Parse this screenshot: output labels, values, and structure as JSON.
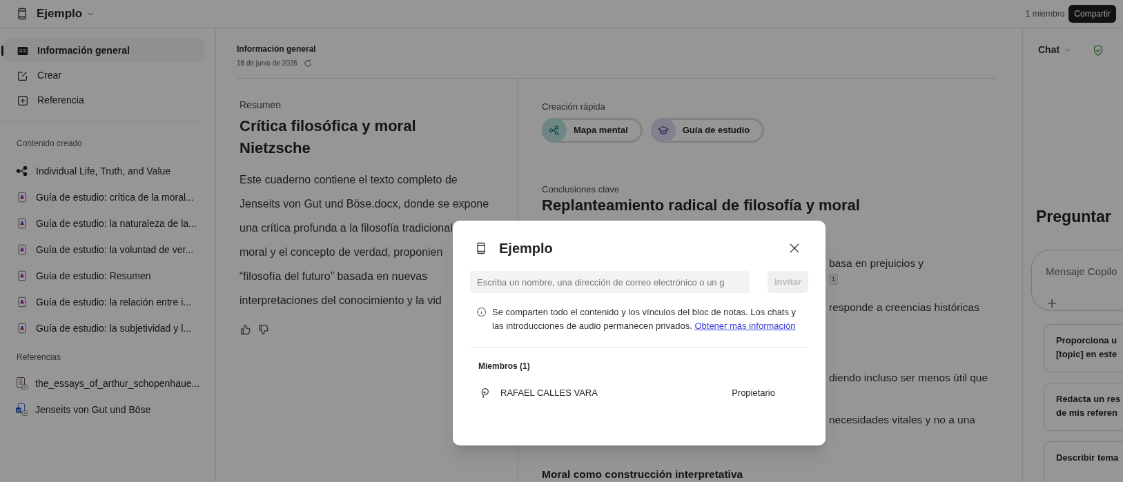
{
  "top_bar": {
    "notebook_title": "Ejemplo",
    "members_count": "1 miembro",
    "share_button": "Compartir"
  },
  "sidebar": {
    "nav": [
      {
        "label": "Información general",
        "selected": true
      },
      {
        "label": "Crear",
        "selected": false
      },
      {
        "label": "Referencia",
        "selected": false
      }
    ],
    "created_heading": "Contenido creado",
    "created": [
      {
        "kind": "mindmap",
        "label": "Individual Life, Truth, and Value"
      },
      {
        "kind": "study_guide",
        "label": "Guía de estudio: crítica de la moral..."
      },
      {
        "kind": "study_guide",
        "label": "Guía de estudio: la naturaleza de la..."
      },
      {
        "kind": "study_guide",
        "label": "Guía de estudio: la voluntad de ver..."
      },
      {
        "kind": "study_guide",
        "label": "Guía de estudio: Resumen"
      },
      {
        "kind": "study_guide",
        "label": "Guía de estudio: la relación entre i..."
      },
      {
        "kind": "study_guide",
        "label": "Guía de estudio: la subjetividad y l..."
      }
    ],
    "references_heading": "Referencias",
    "references": [
      {
        "kind": "pdf",
        "label": "the_essays_of_arthur_schopenhaue..."
      },
      {
        "kind": "word",
        "label": "Jenseits von Gut und Böse"
      }
    ]
  },
  "overview": {
    "title": "Información general",
    "date": "18 de junio de 2026",
    "summary": {
      "label": "Resumen",
      "title": "Crítica filosófica y moral Nietzsche",
      "text_lines": [
        "Este cuaderno contiene el texto completo de",
        "Jenseits von Gut und Böse.docx, donde se expone",
        "una crítica profunda a la filosofía tradicional",
        "moral y el concepto de verdad, proponien",
        "“filosofía del futuro” basada en nuevas",
        "interpretaciones del conocimiento y la vid"
      ]
    },
    "quick_create": {
      "label": "Creación rápida",
      "items": [
        {
          "kind": "mindmap",
          "label": "Mapa mental"
        },
        {
          "kind": "study_guide",
          "label": "Guía de estudio"
        }
      ]
    },
    "key_conclusions": {
      "label": "Conclusiones clave",
      "title": "Replanteamiento radical de filosofía y moral",
      "fragments": [
        {
          "text": "basa en prejuicios y",
          "citation": "1"
        },
        {
          "text": "responde a creencias históricas"
        },
        {
          "text": "diendo incluso ser menos útil que"
        },
        {
          "text": "necesidades vitales y no a una"
        }
      ],
      "subtitle": "Moral como construcción interpretativa"
    }
  },
  "chat": {
    "title": "Chat",
    "heading": "Preguntar",
    "placeholder": "Mensaje Copilo",
    "suggestions": [
      {
        "lines": [
          "Proporciona u",
          "[topic] en este"
        ]
      },
      {
        "lines": [
          "Redacta un res",
          "de mis referen"
        ]
      },
      {
        "lines": [
          "Describir tema"
        ]
      }
    ]
  },
  "share_dialog": {
    "title": "Ejemplo",
    "invite_placeholder": "Escriba un nombre, una dirección de correo electrónico o un g",
    "invite_button": "Invitar",
    "invite_disabled": true,
    "notice": "Se comparten todo el contenido y los vínculos del bloc de notas. Los chats y las introducciones de audio permanecen privados.",
    "notice_link": "Obtener más información",
    "members_heading": "Miembros (1)",
    "members": [
      {
        "name": "RAFAEL CALLES VARA",
        "role": "Propietario"
      }
    ]
  }
}
